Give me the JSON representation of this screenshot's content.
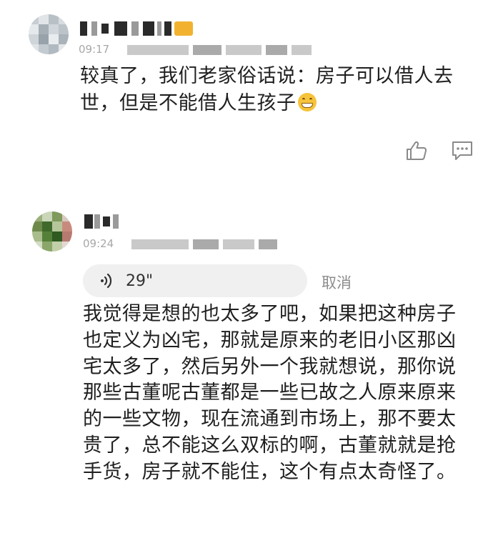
{
  "comments": [
    {
      "time": "09:17",
      "content": "较真了，我们老家俗话说：房子可以借人去世，但是不能借人生孩子",
      "emoji": "grinning-face-emoji"
    },
    {
      "time": "09:24",
      "voice": {
        "duration": "29\"",
        "cancel_label": "取消"
      },
      "content": "我觉得是想的也太多了吧，如果把这种房子也定义为凶宅，那就是原来的老旧小区那凶宅太多了，然后另外一个我就想说，那你说那些古董呢古董都是一些已故之人原来原来的一些文物，现在流通到市场上，那不要太贵了，总不能这么双标的啊，古董就就是抢手货，房子就不能住，这个有点太奇怪了。"
    }
  ],
  "icons": {
    "like": "thumbs-up-icon",
    "reply": "comment-bubble-icon",
    "voice": "sound-wave-icon"
  },
  "colors": {
    "text": "#1f1f1f",
    "meta": "#a8a8a8",
    "icon": "#8a8a8a",
    "voice_bg": "#f0f0f0"
  }
}
